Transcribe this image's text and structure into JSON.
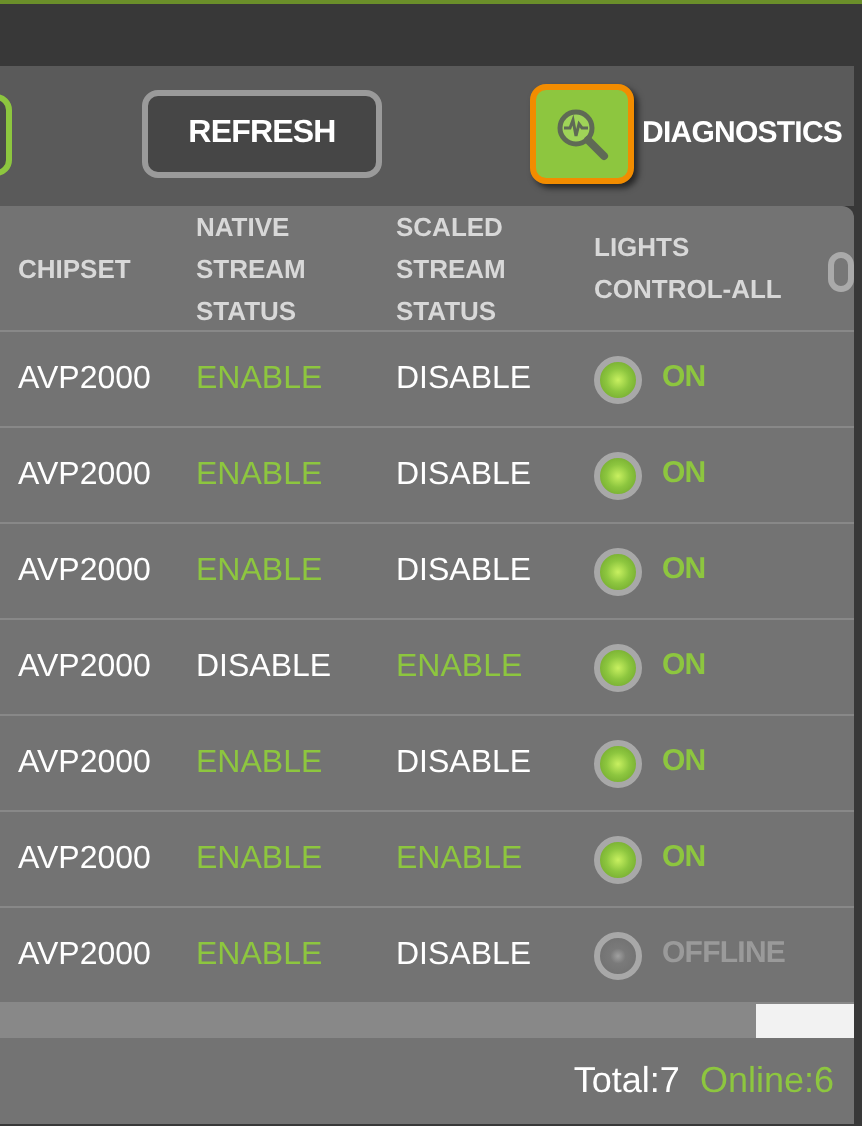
{
  "toolbar": {
    "refresh": "REFRESH",
    "diagnostics": "DIAGNOSTICS"
  },
  "table": {
    "toggle_all": {
      "on": false
    },
    "columns": [
      "CHIPSET",
      "NATIVE STREAM STATUS",
      "SCALED STREAM STATUS",
      "LIGHTS CONTROL-ALL"
    ],
    "rows": [
      {
        "chipset": "AVP2000",
        "native": {
          "text": "ENABLE",
          "on": true
        },
        "scaled": {
          "text": "DISABLE",
          "on": false
        },
        "light": {
          "text": "ON",
          "online": true
        }
      },
      {
        "chipset": "AVP2000",
        "native": {
          "text": "ENABLE",
          "on": true
        },
        "scaled": {
          "text": "DISABLE",
          "on": false
        },
        "light": {
          "text": "ON",
          "online": true
        }
      },
      {
        "chipset": "AVP2000",
        "native": {
          "text": "ENABLE",
          "on": true
        },
        "scaled": {
          "text": "DISABLE",
          "on": false
        },
        "light": {
          "text": "ON",
          "online": true
        }
      },
      {
        "chipset": "AVP2000",
        "native": {
          "text": "DISABLE",
          "on": false
        },
        "scaled": {
          "text": "ENABLE",
          "on": true
        },
        "light": {
          "text": "ON",
          "online": true
        }
      },
      {
        "chipset": "AVP2000",
        "native": {
          "text": "ENABLE",
          "on": true
        },
        "scaled": {
          "text": "DISABLE",
          "on": false
        },
        "light": {
          "text": "ON",
          "online": true
        }
      },
      {
        "chipset": "AVP2000",
        "native": {
          "text": "ENABLE",
          "on": true
        },
        "scaled": {
          "text": "ENABLE",
          "on": true
        },
        "light": {
          "text": "ON",
          "online": true
        }
      },
      {
        "chipset": "AVP2000",
        "native": {
          "text": "ENABLE",
          "on": true
        },
        "scaled": {
          "text": "DISABLE",
          "on": false
        },
        "light": {
          "text": "OFFLINE",
          "online": false
        }
      }
    ]
  },
  "footer": {
    "total": "Total:7",
    "online": "Online:6"
  }
}
